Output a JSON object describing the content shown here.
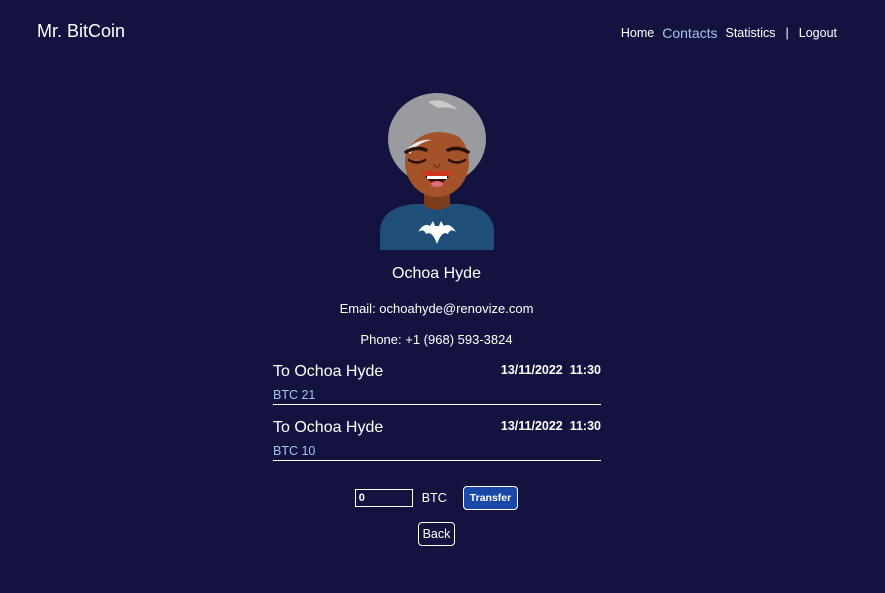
{
  "header": {
    "brand": "Mr. BitCoin",
    "nav": {
      "home": "Home",
      "contacts": "Contacts",
      "statistics": "Statistics",
      "separator": "|",
      "logout": "Logout"
    },
    "active_color": "#9fc6f2"
  },
  "contact": {
    "name": "Ochoa Hyde",
    "email": "Email: ochoahyde@renovize.com",
    "phone": "Phone: +1 (968) 593-3824",
    "avatar_icon": "avatar-woman-icon"
  },
  "moves": [
    {
      "to": "To Ochoa Hyde",
      "date": "13/11/2022  11:30",
      "amount": "BTC 21"
    },
    {
      "to": "To Ochoa Hyde",
      "date": "13/11/2022  11:30",
      "amount": "BTC 10"
    }
  ],
  "transfer": {
    "value": "0",
    "currency": "BTC",
    "button": "Transfer"
  },
  "back_button": "Back",
  "colors": {
    "background": "#141340",
    "primary_button": "#1a48a8",
    "accent": "#9fc6f2"
  }
}
